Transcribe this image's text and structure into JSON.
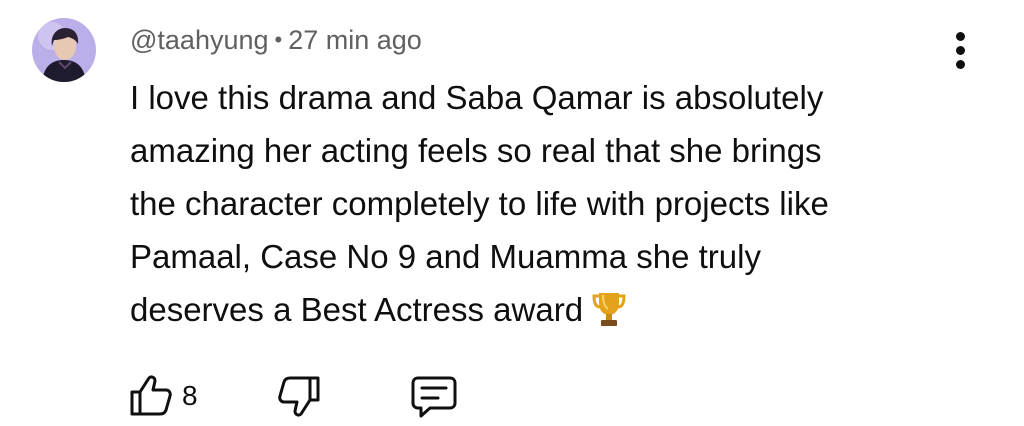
{
  "comment": {
    "handle": "@taahyung",
    "separator": "•",
    "time": "27 min ago",
    "lines": [
      "I love this drama and Saba Qamar is absolutely",
      "amazing her acting feels so real that she brings",
      "the character completely to life with projects like",
      "Pamaal, Case No 9 and Muamma she truly",
      "deserves a Best Actress award"
    ],
    "emoji": "trophy-icon",
    "like_count": "8"
  },
  "icons": {
    "like": "thumbs-up-icon",
    "dislike": "thumbs-down-icon",
    "reply": "reply-icon",
    "more": "more-vertical-icon"
  },
  "colors": {
    "text": "#0f0f0f",
    "meta": "#606060",
    "avatar_bg": "#b9a8e6",
    "trophy": "#e3a21a"
  }
}
